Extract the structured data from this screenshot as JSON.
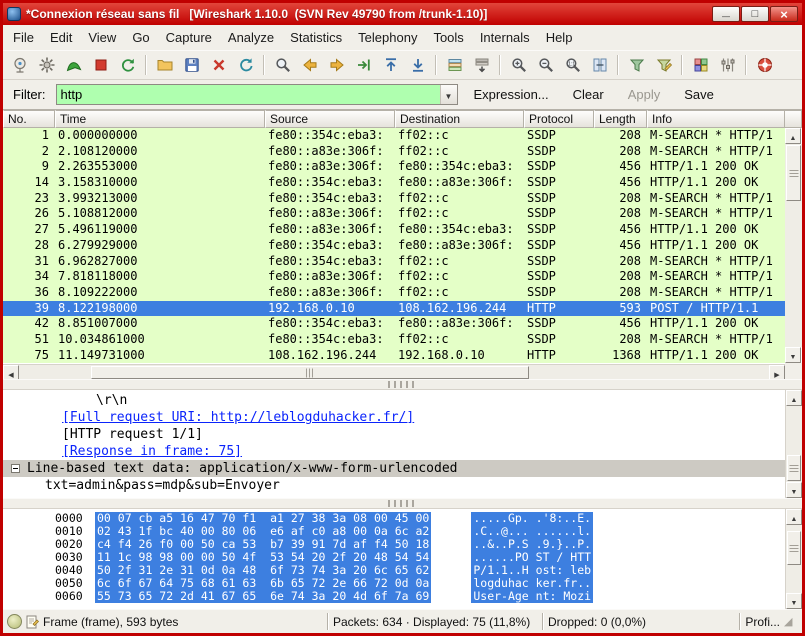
{
  "window": {
    "title": "*Connexion réseau sans fil   [Wireshark 1.10.0  (SVN Rev 49790 from /trunk-1.10)]"
  },
  "menu": {
    "items": [
      "File",
      "Edit",
      "View",
      "Go",
      "Capture",
      "Analyze",
      "Statistics",
      "Telephony",
      "Tools",
      "Internals",
      "Help"
    ]
  },
  "toolbar": {
    "items": [
      "list-interfaces",
      "capture-options",
      "start-capture",
      "stop-capture",
      "restart-capture",
      "|",
      "open-file",
      "save-file",
      "close-file",
      "reload",
      "|",
      "find-packet",
      "go-back",
      "go-forward",
      "goto-packet",
      "goto-top",
      "goto-bottom",
      "|",
      "colorize",
      "autoscroll",
      "|",
      "zoom-in",
      "zoom-out",
      "zoom-100",
      "resize-columns",
      "|",
      "capture-filter",
      "display-filter",
      "|",
      "coloring-rules",
      "preferences",
      "|",
      "help"
    ]
  },
  "filter": {
    "label": "Filter:",
    "value": "http",
    "buttons": [
      {
        "label": "Expression...",
        "enabled": true
      },
      {
        "label": "Clear",
        "enabled": true
      },
      {
        "label": "Apply",
        "enabled": false
      },
      {
        "label": "Save",
        "enabled": true
      }
    ]
  },
  "packet_list": {
    "columns": [
      "No.",
      "Time",
      "Source",
      "Destination",
      "Protocol",
      "Length",
      "Info"
    ],
    "rows": [
      {
        "no": "1",
        "time": "0.000000000",
        "source": "fe80::354c:eba3:",
        "destination": "ff02::c",
        "protocol": "SSDP",
        "length": "208",
        "info": "M-SEARCH * HTTP/1",
        "selected": false
      },
      {
        "no": "2",
        "time": "2.108120000",
        "source": "fe80::a83e:306f:",
        "destination": "ff02::c",
        "protocol": "SSDP",
        "length": "208",
        "info": "M-SEARCH * HTTP/1",
        "selected": false
      },
      {
        "no": "9",
        "time": "2.263553000",
        "source": "fe80::a83e:306f:",
        "destination": "fe80::354c:eba3:",
        "protocol": "SSDP",
        "length": "456",
        "info": "HTTP/1.1 200 OK",
        "selected": false
      },
      {
        "no": "14",
        "time": "3.158310000",
        "source": "fe80::354c:eba3:",
        "destination": "fe80::a83e:306f:",
        "protocol": "SSDP",
        "length": "456",
        "info": "HTTP/1.1 200 OK",
        "selected": false
      },
      {
        "no": "23",
        "time": "3.993213000",
        "source": "fe80::354c:eba3:",
        "destination": "ff02::c",
        "protocol": "SSDP",
        "length": "208",
        "info": "M-SEARCH * HTTP/1",
        "selected": false
      },
      {
        "no": "26",
        "time": "5.108812000",
        "source": "fe80::a83e:306f:",
        "destination": "ff02::c",
        "protocol": "SSDP",
        "length": "208",
        "info": "M-SEARCH * HTTP/1",
        "selected": false
      },
      {
        "no": "27",
        "time": "5.496119000",
        "source": "fe80::a83e:306f:",
        "destination": "fe80::354c:eba3:",
        "protocol": "SSDP",
        "length": "456",
        "info": "HTTP/1.1 200 OK",
        "selected": false
      },
      {
        "no": "28",
        "time": "6.279929000",
        "source": "fe80::354c:eba3:",
        "destination": "fe80::a83e:306f:",
        "protocol": "SSDP",
        "length": "456",
        "info": "HTTP/1.1 200 OK",
        "selected": false
      },
      {
        "no": "31",
        "time": "6.962827000",
        "source": "fe80::354c:eba3:",
        "destination": "ff02::c",
        "protocol": "SSDP",
        "length": "208",
        "info": "M-SEARCH * HTTP/1",
        "selected": false
      },
      {
        "no": "34",
        "time": "7.818118000",
        "source": "fe80::a83e:306f:",
        "destination": "ff02::c",
        "protocol": "SSDP",
        "length": "208",
        "info": "M-SEARCH * HTTP/1",
        "selected": false
      },
      {
        "no": "36",
        "time": "8.109222000",
        "source": "fe80::a83e:306f:",
        "destination": "ff02::c",
        "protocol": "SSDP",
        "length": "208",
        "info": "M-SEARCH * HTTP/1",
        "selected": false
      },
      {
        "no": "39",
        "time": "8.122198000",
        "source": "192.168.0.10",
        "destination": "108.162.196.244",
        "protocol": "HTTP",
        "length": "593",
        "info": "POST / HTTP/1.1",
        "selected": true
      },
      {
        "no": "42",
        "time": "8.851007000",
        "source": "fe80::354c:eba3:",
        "destination": "fe80::a83e:306f:",
        "protocol": "SSDP",
        "length": "456",
        "info": "HTTP/1.1 200 OK",
        "selected": false
      },
      {
        "no": "51",
        "time": "10.034861000",
        "source": "fe80::354c:eba3:",
        "destination": "ff02::c",
        "protocol": "SSDP",
        "length": "208",
        "info": "M-SEARCH * HTTP/1",
        "selected": false
      },
      {
        "no": "75",
        "time": "11.149731000",
        "source": "108.162.196.244",
        "destination": "192.168.0.10",
        "protocol": "HTTP",
        "length": "1368",
        "info": "HTTP/1.1 200 OK",
        "selected": false
      }
    ]
  },
  "details": {
    "lines": [
      {
        "text": "\\r\\n",
        "indent": 5,
        "style": "plain",
        "expander": false
      },
      {
        "text": "[Full request URI: http://leblogduhacker.fr/]",
        "indent": 3,
        "style": "link",
        "expander": false
      },
      {
        "text": "[HTTP request 1/1]",
        "indent": 3,
        "style": "plain",
        "expander": false
      },
      {
        "text": "[Response in frame: 75]",
        "indent": 3,
        "style": "link",
        "expander": false
      },
      {
        "text": "Line-based text data: application/x-www-form-urlencoded",
        "indent": 0,
        "style": "selected",
        "expander": true
      },
      {
        "text": "txt=admin&pass=mdp&sub=Envoyer",
        "indent": 2,
        "style": "plain",
        "expander": false
      }
    ]
  },
  "hex": {
    "lines": [
      {
        "offset": "0000",
        "hex": "00 07 cb a5 16 47 70 f1  a1 27 38 3a 08 00 45 00",
        "ascii": ".....Gp. .'8:..E."
      },
      {
        "offset": "0010",
        "hex": "02 43 1f bc 40 00 80 06  e6 af c0 a8 00 0a 6c a2",
        "ascii": ".C..@... ......l."
      },
      {
        "offset": "0020",
        "hex": "c4 f4 26 f0 00 50 ca 53  b7 39 91 7d af f4 50 18",
        "ascii": "..&..P.S .9.}..P."
      },
      {
        "offset": "0030",
        "hex": "11 1c 98 98 00 00 50 4f  53 54 20 2f 20 48 54 54",
        "ascii": "......PO ST / HTT"
      },
      {
        "offset": "0040",
        "hex": "50 2f 31 2e 31 0d 0a 48  6f 73 74 3a 20 6c 65 62",
        "ascii": "P/1.1..H ost: leb"
      },
      {
        "offset": "0050",
        "hex": "6c 6f 67 64 75 68 61 63  6b 65 72 2e 66 72 0d 0a",
        "ascii": "logduhac ker.fr.."
      },
      {
        "offset": "0060",
        "hex": "55 73 65 72 2d 41 67 65  6e 74 3a 20 4d 6f 7a 69",
        "ascii": "User-Age nt: Mozi"
      }
    ]
  },
  "status": {
    "sections": [
      "Frame (frame), 593 bytes",
      "Packets: 634 · Displayed: 75 (11,8%)",
      "Dropped: 0 (0,0%)",
      "Profi..."
    ]
  },
  "colors": {
    "titlebar": "#c00000",
    "filter_valid_bg": "#afffaf",
    "row_http_bg": "#e4ffc7",
    "selected_row_bg": "#3d7fe0",
    "link": "#0b24fb"
  }
}
